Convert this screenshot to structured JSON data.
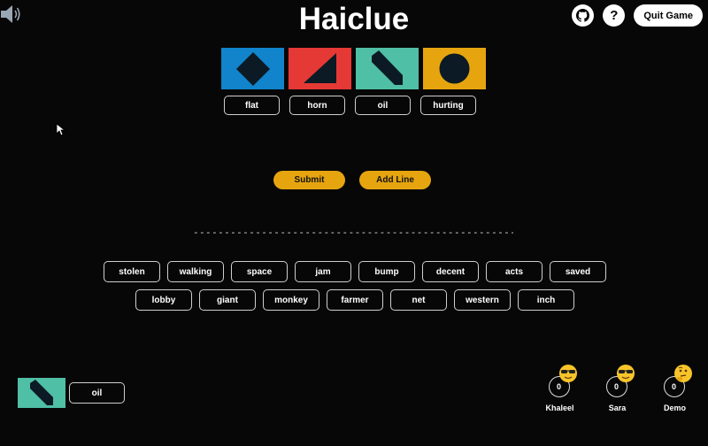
{
  "header": {
    "title": "Haiclue",
    "help_label": "?",
    "quit_label": "Quit Game"
  },
  "colors": {
    "blue": "#1184cc",
    "red": "#e53935",
    "teal": "#4fbfa5",
    "yellow": "#e6a50f",
    "shape": "#0b1a24"
  },
  "cards": [
    {
      "color": "blue",
      "icon": "diamond-icon"
    },
    {
      "color": "red",
      "icon": "triangle-icon"
    },
    {
      "color": "teal",
      "icon": "diagonal-bar-icon"
    },
    {
      "color": "yellow",
      "icon": "circle-icon"
    }
  ],
  "card_words": [
    "flat",
    "horn",
    "oil",
    "hurting"
  ],
  "actions": {
    "submit_label": "Submit",
    "add_line_label": "Add Line"
  },
  "divider": "-----------------------------------------------------",
  "word_pool": {
    "row1": [
      "stolen",
      "walking",
      "space",
      "jam",
      "bump",
      "decent",
      "acts",
      "saved"
    ],
    "row2": [
      "lobby",
      "giant",
      "monkey",
      "farmer",
      "net",
      "western",
      "inch"
    ]
  },
  "my_card": {
    "color": "teal",
    "icon": "diagonal-bar-icon",
    "word": "oil"
  },
  "players": [
    {
      "name": "Khaleel",
      "score": "0",
      "emoji": "sunglasses-emoji-icon"
    },
    {
      "name": "Sara",
      "score": "0",
      "emoji": "sunglasses-emoji-icon"
    },
    {
      "name": "Demo",
      "score": "0",
      "emoji": "thinking-emoji-icon"
    }
  ]
}
